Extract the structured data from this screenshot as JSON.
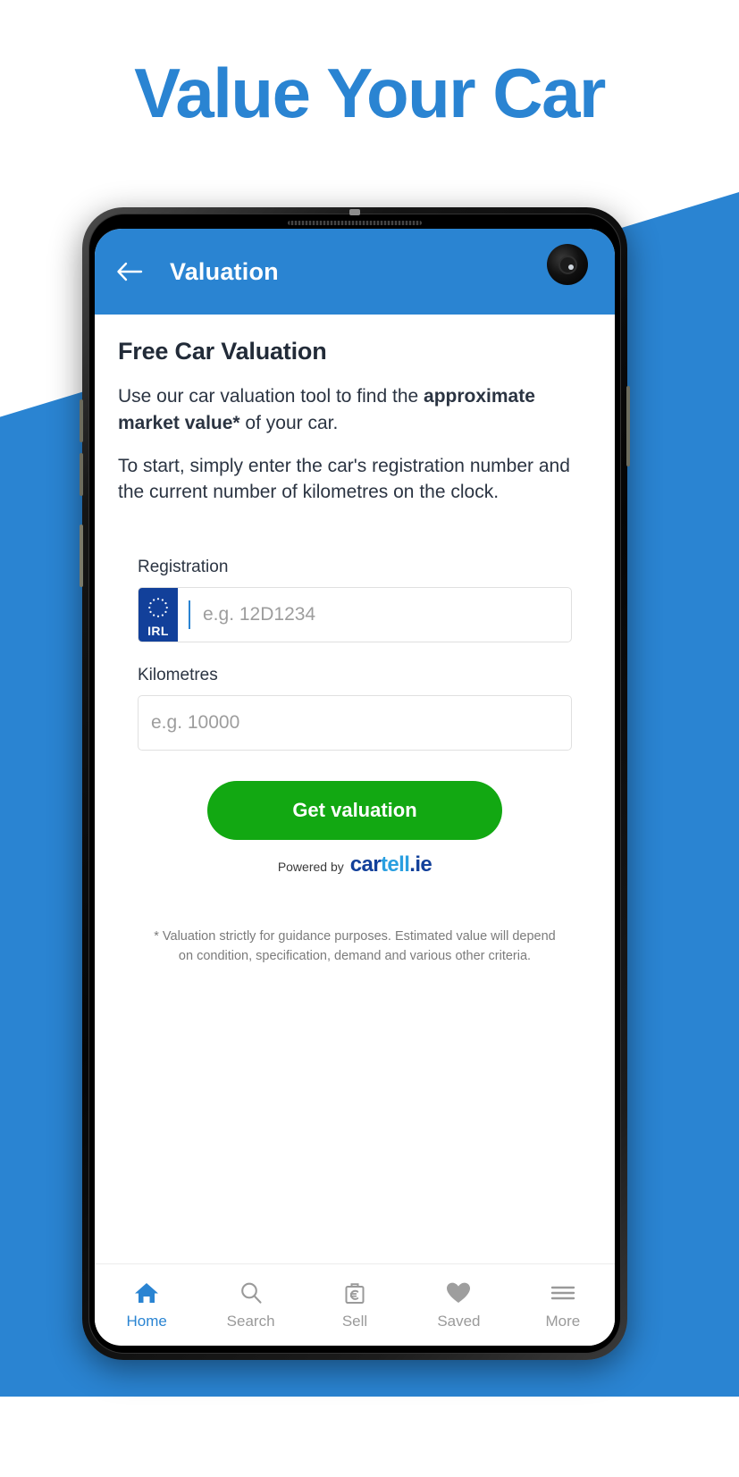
{
  "page": {
    "title": "Value Your Car",
    "accent_blue": "#2a84d2",
    "accent_green": "#12a812",
    "plate_blue": "#12409a"
  },
  "appbar": {
    "back_icon": "arrow-left-icon",
    "title": "Valuation",
    "camera_icon": "front-camera-punch-hole"
  },
  "main": {
    "heading": "Free Car Valuation",
    "paragraph1_part1": "Use our car valuation tool to find the ",
    "paragraph1_bold": "approximate market value*",
    "paragraph1_part2": " of your car.",
    "paragraph2": "To start, simply enter the car's registration number and the current number of kilometres on the clock.",
    "disclaimer": "* Valuation strictly for guidance purposes. Estimated value will depend on condition, specification, demand and various other criteria."
  },
  "form": {
    "registration": {
      "label": "Registration",
      "placeholder": "e.g. 12D1234",
      "value": "",
      "plate_country_code": "IRL",
      "plate_icon": "eu-stars-icon"
    },
    "kilometres": {
      "label": "Kilometres",
      "placeholder": "e.g. 10000",
      "value": ""
    },
    "submit_label": "Get valuation",
    "powered_by_prefix": "Powered by",
    "brand_part1": "car",
    "brand_part2": "tell",
    "brand_part3": ".ie"
  },
  "bottom_nav": {
    "items": [
      {
        "label": "Home",
        "icon": "home-icon",
        "active": true
      },
      {
        "label": "Search",
        "icon": "search-icon",
        "active": false
      },
      {
        "label": "Sell",
        "icon": "price-tag-euro-icon",
        "active": false
      },
      {
        "label": "Saved",
        "icon": "heart-icon",
        "active": false
      },
      {
        "label": "More",
        "icon": "hamburger-menu-icon",
        "active": false
      }
    ]
  }
}
